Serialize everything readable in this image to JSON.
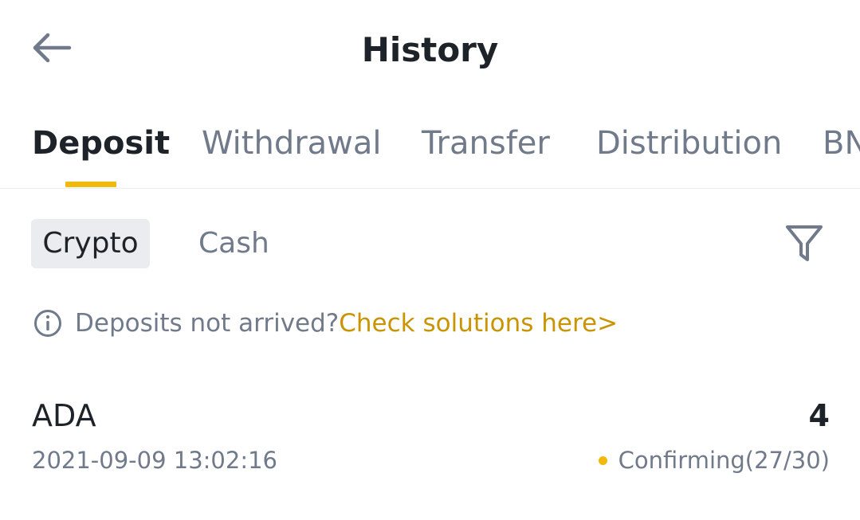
{
  "header": {
    "title": "History",
    "back_icon": "arrow-left-icon"
  },
  "tabs": [
    {
      "label": "Deposit",
      "active": true
    },
    {
      "label": "Withdrawal",
      "active": false
    },
    {
      "label": "Transfer",
      "active": false
    },
    {
      "label": "Distribution",
      "active": false
    },
    {
      "label": "BN",
      "active": false
    }
  ],
  "subtabs": [
    {
      "label": "Crypto",
      "active": true
    },
    {
      "label": "Cash",
      "active": false
    }
  ],
  "filter_icon": "filter-funnel-icon",
  "notice": {
    "icon": "info-circle-icon",
    "text": "Deposits not arrived?",
    "link": "Check solutions here>"
  },
  "records": [
    {
      "coin": "ADA",
      "amount": "4",
      "datetime": "2021-09-09 13:02:16",
      "status": "Confirming(27/30)"
    }
  ],
  "colors": {
    "accent": "#f0b90b",
    "link": "#c99400",
    "text_primary": "#1e2329",
    "text_secondary": "#707a8a",
    "divider": "#eaecef"
  }
}
